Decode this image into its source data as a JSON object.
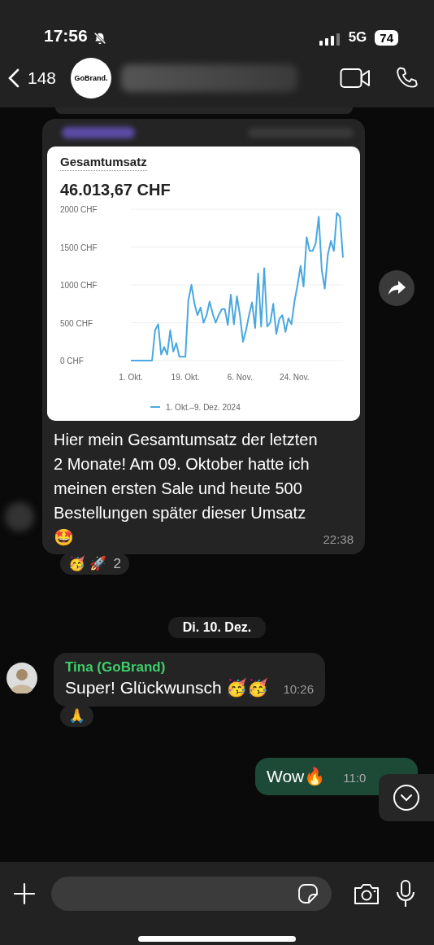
{
  "status_bar": {
    "time": "17:56",
    "network": "5G",
    "battery": "74"
  },
  "header": {
    "back_count": "148",
    "avatar_text": "GoBrand."
  },
  "messages": [
    {
      "kind": "chart_post",
      "total": "46.013,67 CHF",
      "chart_data": {
        "type": "line",
        "title": "Gesamtumsatz",
        "grid": true,
        "categories": [
          "1. Okt.",
          null,
          null,
          null,
          null,
          null,
          null,
          null,
          null,
          null,
          null,
          null,
          null,
          null,
          null,
          null,
          null,
          null,
          "19. Okt.",
          null,
          null,
          null,
          null,
          null,
          null,
          null,
          null,
          null,
          null,
          null,
          null,
          null,
          null,
          null,
          null,
          null,
          "6. Nov.",
          null,
          null,
          null,
          null,
          null,
          null,
          null,
          null,
          null,
          null,
          null,
          null,
          null,
          null,
          null,
          null,
          null,
          "24. Nov.",
          null,
          null,
          null,
          null,
          null,
          null,
          null,
          null,
          null,
          null,
          null,
          null,
          null,
          null,
          null,
          null
        ],
        "ylim": [
          0,
          2000
        ],
        "yticks": [
          {
            "value": 0,
            "label": "0 CHF"
          },
          {
            "value": 500,
            "label": "500 CHF"
          },
          {
            "value": 1000,
            "label": "1000 CHF"
          },
          {
            "value": 1500,
            "label": "1500 CHF"
          },
          {
            "value": 2000,
            "label": "2000 CHF"
          }
        ],
        "series": [
          {
            "name": "1. Okt.–9. Dez. 2024",
            "color": "#4aa8e0",
            "values": [
              0,
              0,
              0,
              0,
              0,
              0,
              0,
              0,
              400,
              480,
              80,
              180,
              80,
              400,
              120,
              230,
              50,
              50,
              50,
              800,
              1000,
              750,
              600,
              700,
              500,
              600,
              780,
              620,
              500,
              600,
              680,
              680,
              470,
              870,
              480,
              850,
              600,
              250,
              400,
              600,
              770,
              430,
              1150,
              450,
              1220,
              450,
              500,
              750,
              350,
              550,
              600,
              380,
              560,
              480,
              780,
              1000,
              1250,
              980,
              1630,
              1450,
              1450,
              1550,
              1900,
              1200,
              950,
              1400,
              1580,
              1450,
              1950,
              1900,
              1360
            ]
          }
        ]
      },
      "text": "Hier mein Gesamtumsatz der letzten 2 Monate! Am 09. Oktober hatte ich meinen ersten Sale und heute 500 Bestellungen später dieser Umsatz 🤩",
      "time": "22:38",
      "reactions": {
        "emojis": "🥳 🚀",
        "count": "2"
      }
    },
    {
      "kind": "date",
      "text": "Di. 10. Dez."
    },
    {
      "kind": "incoming",
      "sender": "Tina (GoBrand)",
      "text": "Super! Glückwunsch 🥳🥳",
      "time": "10:26",
      "reactions": {
        "emojis": "🙏"
      }
    },
    {
      "kind": "outgoing",
      "text": "Wow🔥",
      "time": "11:0"
    }
  ]
}
